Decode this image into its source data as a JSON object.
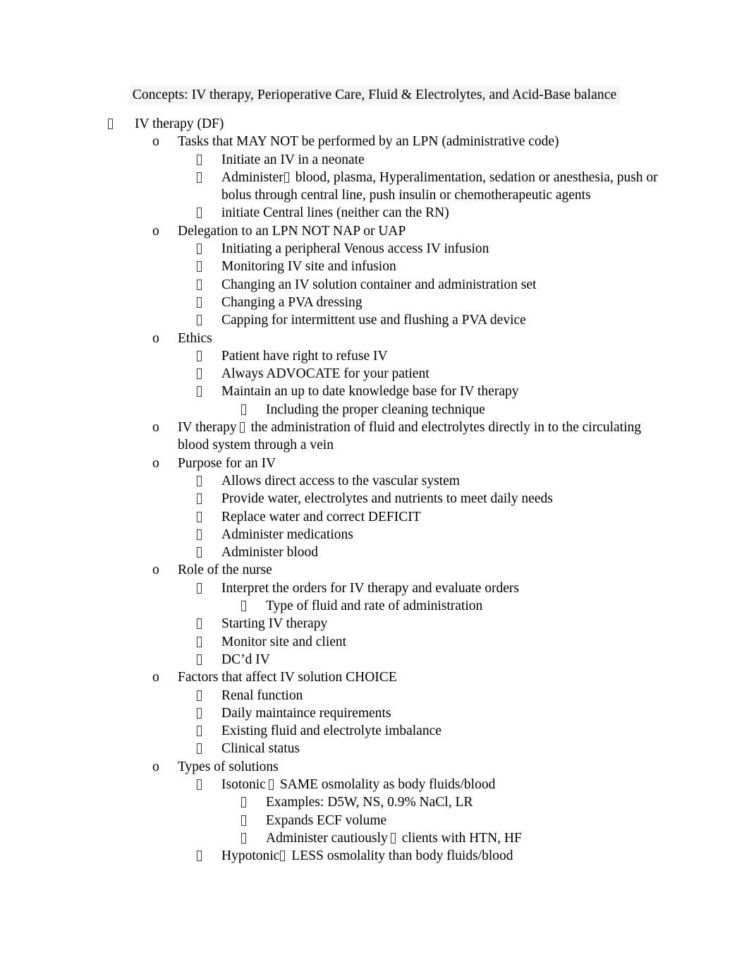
{
  "document": {
    "title": "Concepts: IV therapy, Perioperative Care, Fluid & Electrolytes, and Acid-Base balance",
    "title_highlight_color": "#eeeeee",
    "text_color": "#000000",
    "background_color": "#ffffff",
    "bullet_markers": {
      "level1": "tofu-box",
      "level2": "o",
      "level3": "tofu-box",
      "level4": "tofu-box",
      "inline_separator": "tofu-box"
    },
    "outline": {
      "item_iv_therapy_df": "IV therapy (DF)",
      "item_tasks_not_lpn": "Tasks that MAY NOT be performed by an LPN (administrative code)",
      "item_initiate_neonate": "Initiate an IV in a neonate",
      "item_administer_pre": "Administer",
      "item_administer_post": "blood, plasma, Hyperalimentation, sedation or anesthesia, push or bolus through central line, push insulin or chemotherapeutic agents",
      "item_initiate_central_lines": "initiate Central lines (neither can the RN)",
      "item_delegation_lpn": "Delegation to an LPN NOT NAP or UAP",
      "item_initiating_peripheral": "Initiating a peripheral Venous access IV infusion",
      "item_monitoring_site": "Monitoring IV site and infusion",
      "item_changing_container": "Changing an IV solution container and administration set",
      "item_changing_pva_dressing": "Changing a PVA dressing",
      "item_capping_flushing": "Capping for intermittent use and flushing a PVA device",
      "item_ethics": "Ethics",
      "item_right_refuse": "Patient have right to refuse IV",
      "item_always_advocate": "Always ADVOCATE for your patient",
      "item_maintain_knowledge": "Maintain an up to date knowledge base for IV therapy",
      "item_including_cleaning": "Including the proper cleaning technique",
      "item_iv_therapy_def_pre": "IV therapy",
      "item_iv_therapy_def_post": "the administration of fluid and electrolytes directly in to the circulating blood system through a vein",
      "item_purpose_iv": "Purpose for an IV",
      "item_allows_direct_access": "Allows direct access to the vascular system",
      "item_provide_water": "Provide water, electrolytes and nutrients to meet daily needs",
      "item_replace_water": "Replace water and correct DEFICIT",
      "item_administer_medications": "Administer medications",
      "item_administer_blood": "Administer blood",
      "item_role_of_nurse": "Role of the nurse",
      "item_interpret_orders": "Interpret the orders for IV therapy and evaluate orders",
      "item_type_of_fluid": "Type of fluid and rate of administration",
      "item_starting_iv": "Starting IV therapy",
      "item_monitor_site_client": "Monitor site and client",
      "item_dcd_iv": "DC’d IV",
      "item_factors_choice": "Factors that affect IV solution CHOICE",
      "item_renal_function": "Renal function",
      "item_daily_maintaince": "Daily maintaince requirements",
      "item_existing_imbalance": "Existing fluid and electrolyte imbalance",
      "item_clinical_status": "Clinical status",
      "item_types_of_solutions": "Types of solutions",
      "item_isotonic_pre": "Isotonic",
      "item_isotonic_post": "SAME osmolality as body fluids/blood",
      "item_examples_isotonic": "Examples: D5W, NS, 0.9% NaCl, LR",
      "item_expands_ecf": "Expands ECF volume",
      "item_administer_cautiously_pre": "Administer cautiously",
      "item_administer_cautiously_post": "clients with HTN, HF",
      "item_hypotonic_pre": "Hypotonic",
      "item_hypotonic_post": "LESS osmolality than body fluids/blood"
    }
  }
}
